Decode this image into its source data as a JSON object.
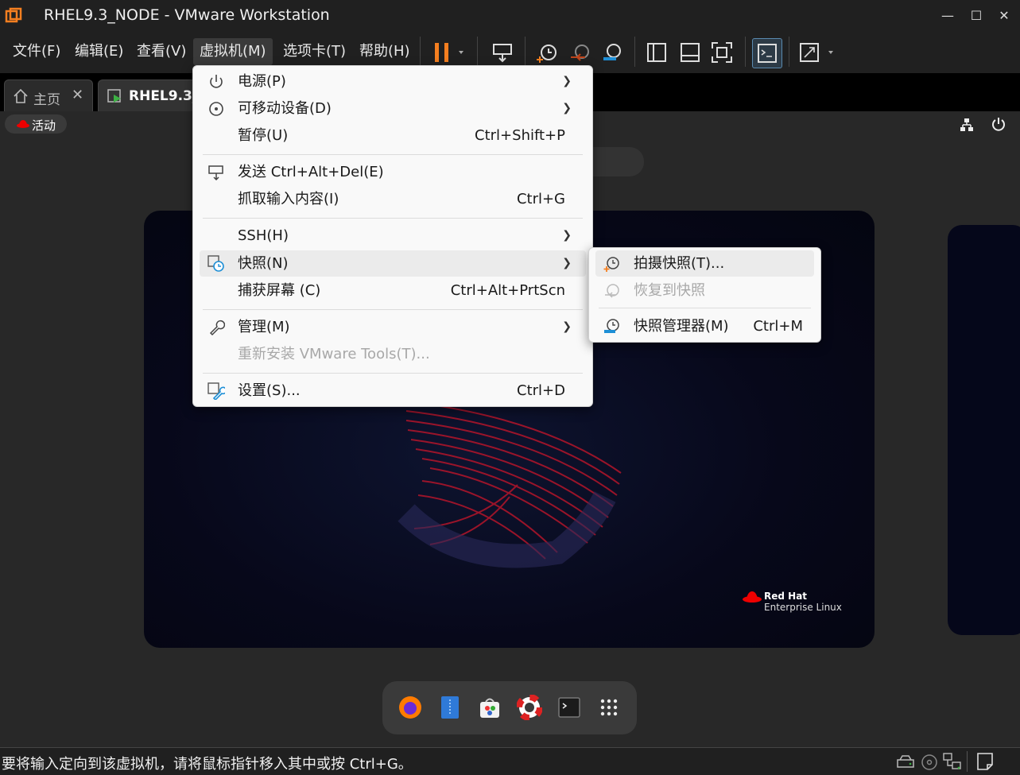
{
  "window": {
    "title": "RHEL9.3_NODE - VMware Workstation",
    "min": "—",
    "max": "☐",
    "close": "✕"
  },
  "menubar": {
    "items": [
      "文件(F)",
      "编辑(E)",
      "查看(V)",
      "虚拟机(M)",
      "选项卡(T)",
      "帮助(H)"
    ]
  },
  "tabs": {
    "home_label": "主页",
    "vm_label": "RHEL9.3_"
  },
  "guest": {
    "activities_label": "活动",
    "brand_line1": "Red Hat",
    "brand_line2": "Enterprise Linux"
  },
  "vm_menu": {
    "items": [
      {
        "label": "电源(P)",
        "shortcut": ""
      },
      {
        "label": "可移动设备(D)",
        "shortcut": ""
      },
      {
        "label": "暂停(U)",
        "shortcut": "Ctrl+Shift+P"
      },
      {
        "label": "发送 Ctrl+Alt+Del(E)",
        "shortcut": ""
      },
      {
        "label": "抓取输入内容(I)",
        "shortcut": "Ctrl+G"
      },
      {
        "label": "SSH(H)",
        "shortcut": ""
      },
      {
        "label": "快照(N)",
        "shortcut": ""
      },
      {
        "label": "捕获屏幕 (C)",
        "shortcut": "Ctrl+Alt+PrtScn"
      },
      {
        "label": "管理(M)",
        "shortcut": ""
      },
      {
        "label": "重新安装 VMware Tools(T)...",
        "shortcut": ""
      },
      {
        "label": "设置(S)...",
        "shortcut": "Ctrl+D"
      }
    ]
  },
  "snapshot_menu": {
    "items": [
      {
        "label": "拍摄快照(T)...",
        "shortcut": ""
      },
      {
        "label": "恢复到快照",
        "shortcut": ""
      },
      {
        "label": "快照管理器(M)",
        "shortcut": "Ctrl+M"
      }
    ]
  },
  "status": {
    "text": "要将输入定向到该虚拟机，请将鼠标指针移入其中或按 Ctrl+G。"
  },
  "colors": {
    "accent_orange": "#f57f20",
    "menu_bg": "#f9f9f9",
    "redhat_red": "#ee0000",
    "snapshot_blue": "#1e8fd6"
  }
}
